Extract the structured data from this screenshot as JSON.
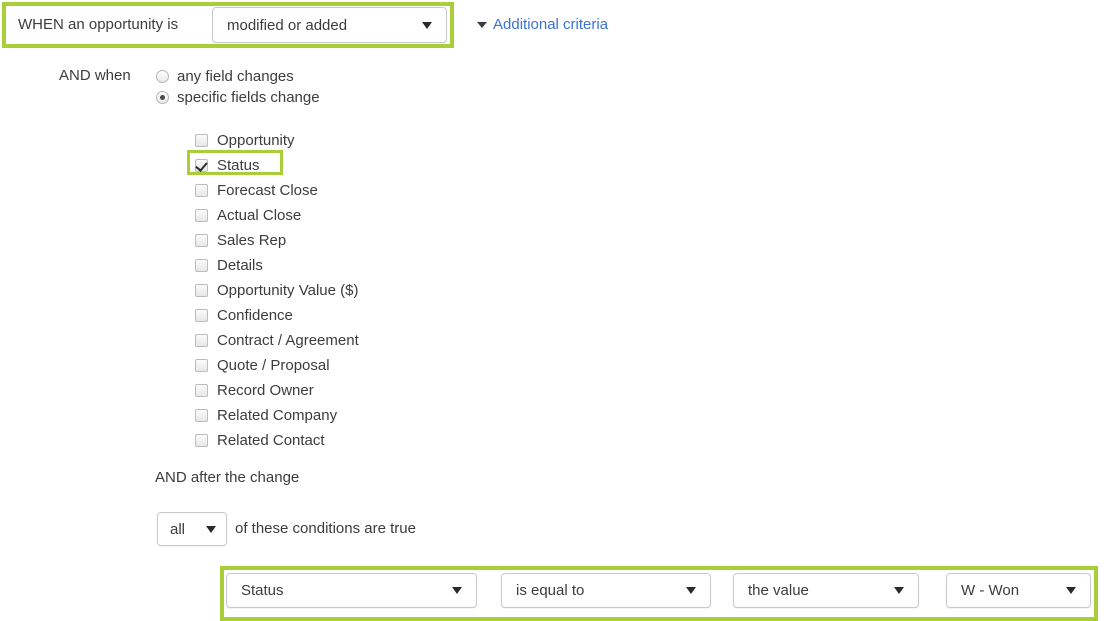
{
  "trigger_row": {
    "when_label": "WHEN an opportunity is",
    "trigger_value": "modified or added",
    "additional_criteria_label": "Additional criteria",
    "caret_icon": "chevron-down-icon",
    "disclosure_icon": "triangle-down-icon",
    "highlight_color": "#a9ce3a",
    "link_color": "#3b73d4"
  },
  "change_scope": {
    "and_when_label": "AND when",
    "options": [
      {
        "label": "any field changes",
        "selected": false
      },
      {
        "label": "specific fields change",
        "selected": true
      }
    ]
  },
  "fields": {
    "items": [
      {
        "label": "Opportunity",
        "checked": false
      },
      {
        "label": "Status",
        "checked": true
      },
      {
        "label": "Forecast Close",
        "checked": false
      },
      {
        "label": "Actual Close",
        "checked": false
      },
      {
        "label": "Sales Rep",
        "checked": false
      },
      {
        "label": "Details",
        "checked": false
      },
      {
        "label": "Opportunity Value ($)",
        "checked": false
      },
      {
        "label": "Confidence",
        "checked": false
      },
      {
        "label": "Contract / Agreement",
        "checked": false
      },
      {
        "label": "Quote / Proposal",
        "checked": false
      },
      {
        "label": "Record Owner",
        "checked": false
      },
      {
        "label": "Related Company",
        "checked": false
      },
      {
        "label": "Related Contact",
        "checked": false
      }
    ]
  },
  "after_change": {
    "heading": "AND after the change",
    "match_value": "all",
    "conditions_text": "of these conditions are true"
  },
  "condition_row": {
    "field": "Status",
    "operator": "is equal to",
    "value_type": "the value",
    "value": "W - Won"
  }
}
